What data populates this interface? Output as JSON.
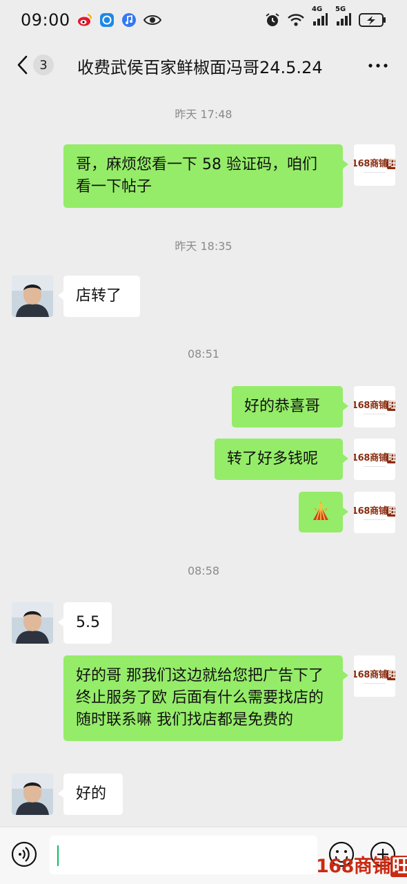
{
  "status_bar": {
    "time": "09:00",
    "icons_left": [
      "weibo-icon",
      "browser-icon",
      "music-icon",
      "eye-icon"
    ],
    "icons_right": [
      "alarm-icon",
      "wifi-icon",
      "signal-4g-icon",
      "signal-5g-icon",
      "battery-charging-icon"
    ],
    "net_4g": "4G",
    "net_5g": "5G"
  },
  "header": {
    "unread_count": "3",
    "title": "收费武侯百家鲜椒面冯哥24.5.24"
  },
  "messages": {
    "t1": "昨天 17:48",
    "m1": "哥，麻烦您看一下 58 验证码，咱们看一下帖子",
    "t2": "昨天 18:35",
    "m2": "店转了",
    "t3": "08:51",
    "m3": "好的恭喜哥",
    "m4": "转了好多钱呢",
    "m5_icon": "firecracker-emoji-icon",
    "t4": "08:58",
    "m6": "5.5",
    "m7": "好的哥 那我们这边就给您把广告下了终止服务了欧 后面有什么需要找店的随时联系嘛 我们找店都是免费的",
    "m8": "好的"
  },
  "avatar_logo": {
    "text": "168商铺",
    "wang": "旺"
  },
  "watermark": {
    "text": "168商铺",
    "wang": "旺"
  },
  "colors": {
    "my_bubble": "#95ec69",
    "other_bubble": "#ffffff",
    "background": "#ededed",
    "brand": "#8a2d10"
  }
}
